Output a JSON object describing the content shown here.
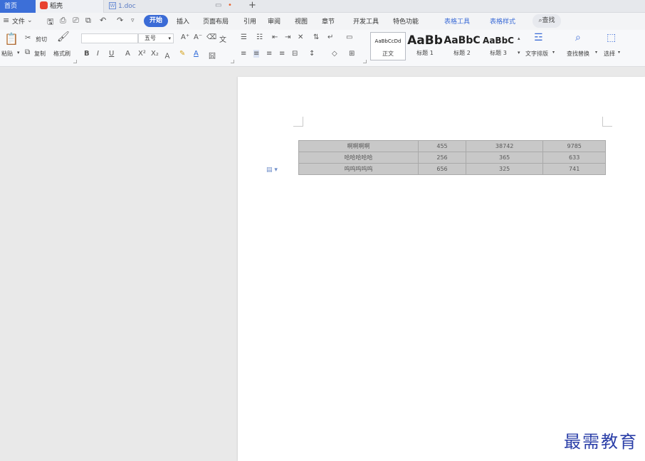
{
  "tabs": {
    "home": "首页",
    "daoke": "稻壳",
    "doc": "1.doc",
    "add": "+"
  },
  "menu": {
    "file": "文件",
    "items": [
      "开始",
      "插入",
      "页面布局",
      "引用",
      "审阅",
      "视图",
      "章节",
      "开发工具",
      "特色功能",
      "表格工具",
      "表格样式"
    ],
    "search": "查找"
  },
  "ribbon": {
    "paste": "粘贴",
    "cut": "剪切",
    "copy": "复制",
    "format_painter": "格式刷",
    "font_size": "五号",
    "styles": [
      {
        "sample": "AaBbCcDd",
        "label": "正文"
      },
      {
        "sample": "AaBb",
        "label": "标题 1"
      },
      {
        "sample": "AaBbC",
        "label": "标题 2"
      },
      {
        "sample": "AaBbC",
        "label": "标题 3"
      }
    ],
    "text_layout": "文字排版",
    "find_replace": "查找替换",
    "select": "选择"
  },
  "table": {
    "rows": [
      [
        "啊啊啊啊",
        "455",
        "38742",
        "9785"
      ],
      [
        "哈哈哈哈哈",
        "256",
        "365",
        "633"
      ],
      [
        "呜呜呜呜呜",
        "656",
        "325",
        "741"
      ]
    ]
  },
  "watermark": "最需教育",
  "colors": {
    "accent": "#3b6bd6",
    "table_fill": "#c8c8c8",
    "watermark": "#2b3fa8"
  }
}
